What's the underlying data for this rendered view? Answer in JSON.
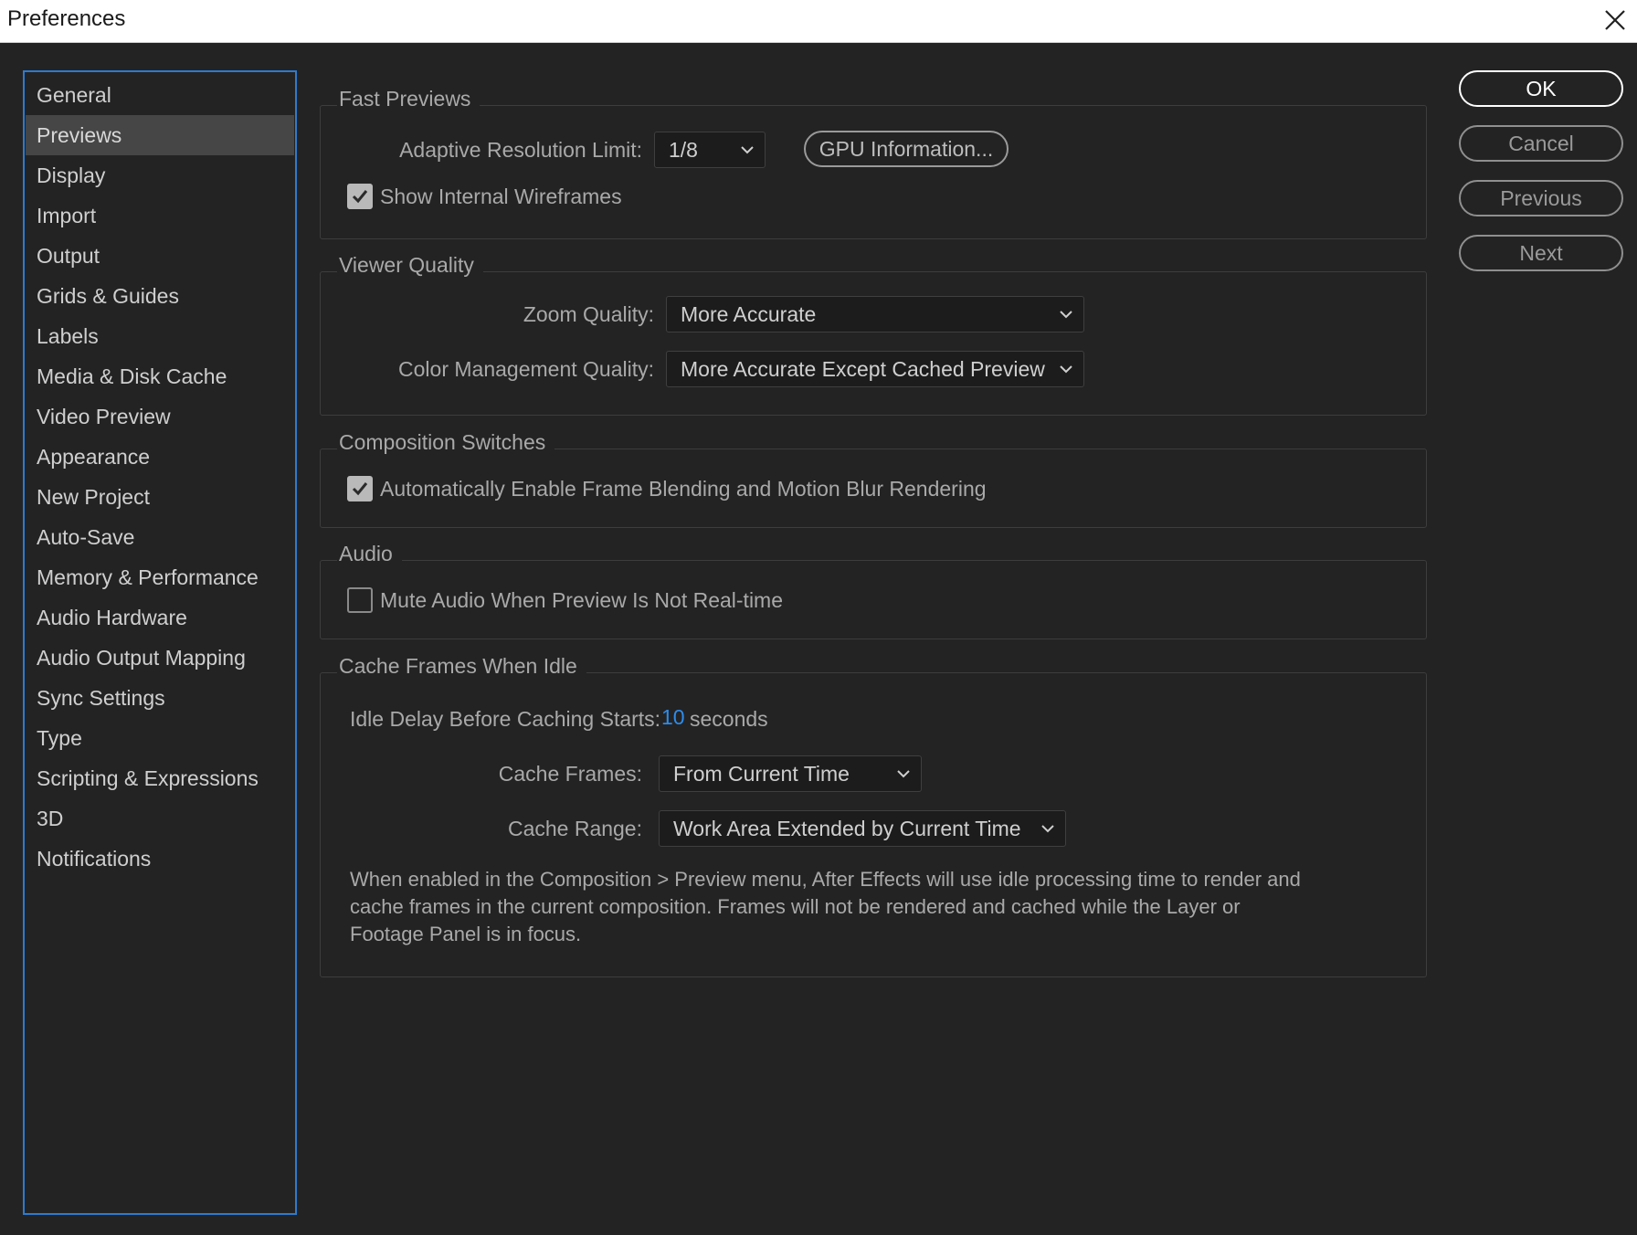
{
  "window": {
    "title": "Preferences"
  },
  "sidebar": {
    "items": [
      {
        "label": "General",
        "active": false
      },
      {
        "label": "Previews",
        "active": true
      },
      {
        "label": "Display",
        "active": false
      },
      {
        "label": "Import",
        "active": false
      },
      {
        "label": "Output",
        "active": false
      },
      {
        "label": "Grids & Guides",
        "active": false
      },
      {
        "label": "Labels",
        "active": false
      },
      {
        "label": "Media & Disk Cache",
        "active": false
      },
      {
        "label": "Video Preview",
        "active": false
      },
      {
        "label": "Appearance",
        "active": false
      },
      {
        "label": "New Project",
        "active": false
      },
      {
        "label": "Auto-Save",
        "active": false
      },
      {
        "label": "Memory & Performance",
        "active": false
      },
      {
        "label": "Audio Hardware",
        "active": false
      },
      {
        "label": "Audio Output Mapping",
        "active": false
      },
      {
        "label": "Sync Settings",
        "active": false
      },
      {
        "label": "Type",
        "active": false
      },
      {
        "label": "Scripting & Expressions",
        "active": false
      },
      {
        "label": "3D",
        "active": false
      },
      {
        "label": "Notifications",
        "active": false
      }
    ]
  },
  "fast_previews": {
    "title": "Fast Previews",
    "adaptive_label": "Adaptive Resolution Limit:",
    "adaptive_value": "1/8",
    "gpu_button": "GPU Information...",
    "wireframes_label": "Show Internal Wireframes",
    "wireframes_checked": true
  },
  "viewer_quality": {
    "title": "Viewer Quality",
    "zoom_label": "Zoom Quality:",
    "zoom_value": "More Accurate",
    "color_label": "Color Management Quality:",
    "color_value": "More Accurate Except Cached Preview"
  },
  "composition_switches": {
    "title": "Composition Switches",
    "frame_blend_label": "Automatically Enable Frame Blending and Motion Blur Rendering",
    "frame_blend_checked": true
  },
  "audio": {
    "title": "Audio",
    "mute_label": "Mute Audio When Preview Is Not Real-time",
    "mute_checked": false
  },
  "cache_idle": {
    "title": "Cache Frames When Idle",
    "idle_label": "Idle Delay Before Caching Starts:",
    "idle_value": "10",
    "idle_unit": "seconds",
    "cache_frames_label": "Cache Frames:",
    "cache_frames_value": "From Current Time",
    "cache_range_label": "Cache Range:",
    "cache_range_value": "Work Area Extended by Current Time",
    "note_line1": "When enabled in the Composition > Preview menu, After Effects will use idle processing time to render and",
    "note_line2": "cache frames in the current composition. Frames will not be rendered and cached while the Layer or",
    "note_line3": "Footage Panel is in focus."
  },
  "buttons": {
    "ok": "OK",
    "cancel": "Cancel",
    "previous": "Previous",
    "next": "Next"
  },
  "colors": {
    "accent_blue": "#2d8ceb",
    "sidebar_border": "#2d7bd0",
    "background": "#232323"
  }
}
